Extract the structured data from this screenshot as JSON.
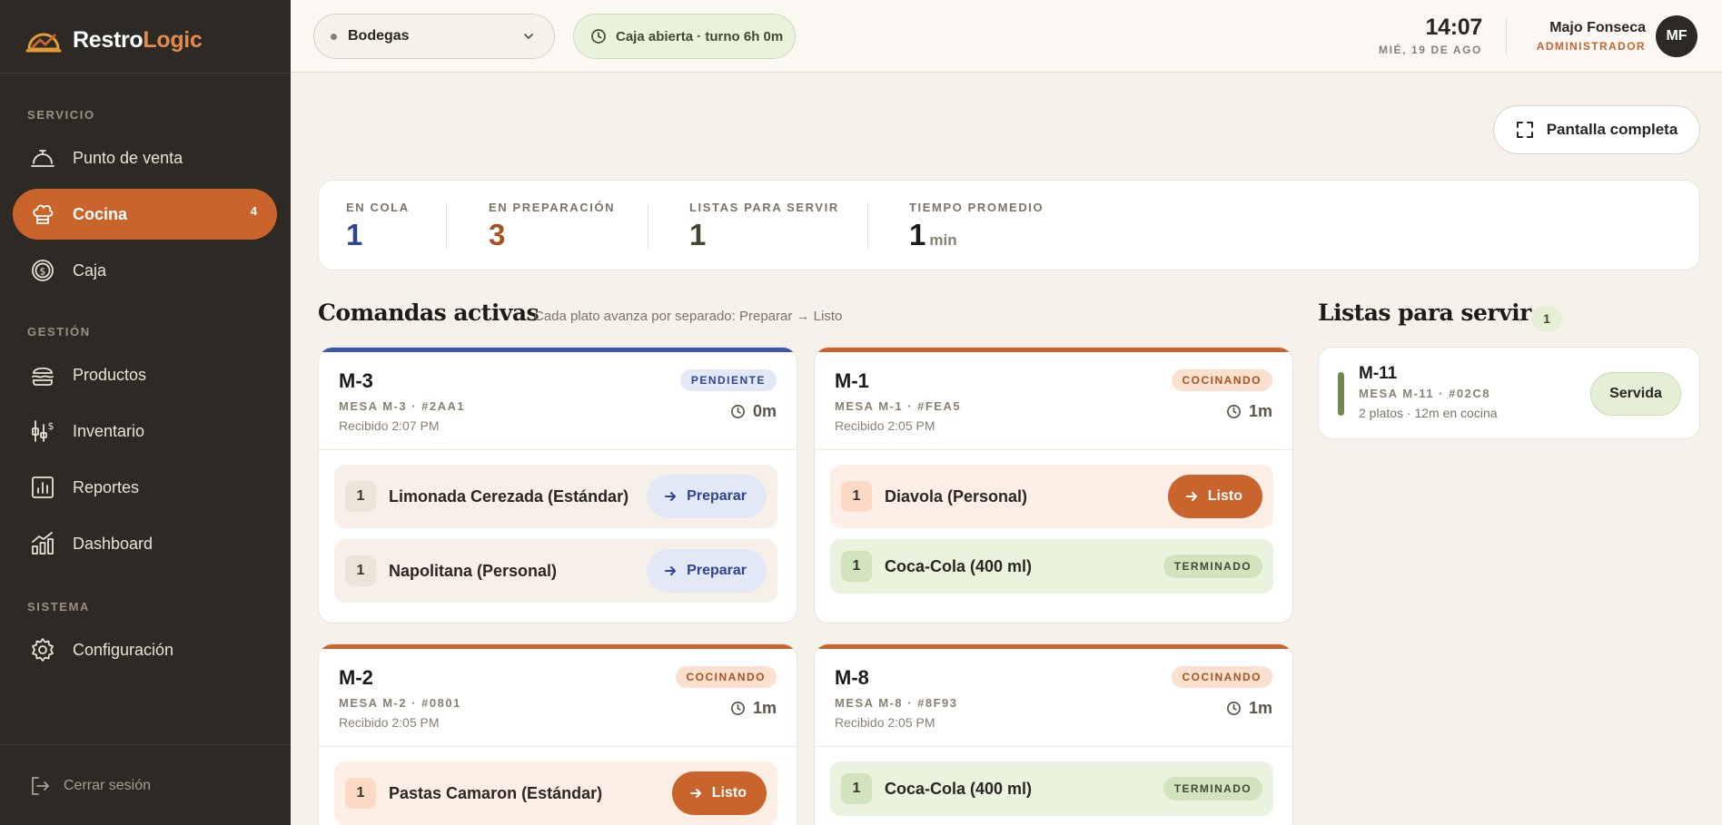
{
  "brand": {
    "name_main": "Restro",
    "name_accent": "Logic"
  },
  "sidebar": {
    "sections": [
      {
        "label": "SERVICIO"
      },
      {
        "label": "GESTIÓN"
      },
      {
        "label": "SISTEMA"
      }
    ],
    "items": [
      {
        "label": "Punto de venta",
        "icon": "service-bell-icon",
        "active": false
      },
      {
        "label": "Cocina",
        "icon": "chef-hat-icon",
        "active": true,
        "badge": "4"
      },
      {
        "label": "Caja",
        "icon": "dollar-coin-icon",
        "active": false
      },
      {
        "label": "Productos",
        "icon": "burger-icon",
        "active": false
      },
      {
        "label": "Inventario",
        "icon": "inventory-scale-icon",
        "active": false
      },
      {
        "label": "Reportes",
        "icon": "bar-chart-icon",
        "active": false
      },
      {
        "label": "Dashboard",
        "icon": "growth-chart-icon",
        "active": false
      },
      {
        "label": "Configuración",
        "icon": "gear-icon",
        "active": false
      }
    ],
    "logout_label": "Cerrar sesión"
  },
  "header": {
    "branch": "Bodegas",
    "cash_status": "Caja abierta · turno 6h 0m",
    "time": "14:07",
    "date": "MIÉ, 19 DE AGO",
    "user_name": "Majo Fonseca",
    "user_role": "ADMINISTRADOR",
    "avatar_initials": "MF"
  },
  "main": {
    "fullscreen_label": "Pantalla completa",
    "stats": [
      {
        "label": "EN COLA",
        "value": "1",
        "unit": "",
        "color": "#2e4592"
      },
      {
        "label": "EN PREPARACIÓN",
        "value": "3",
        "unit": "",
        "color": "#a3541f"
      },
      {
        "label": "LISTAS PARA SERVIR",
        "value": "1",
        "unit": "",
        "color": "#3f4a34"
      },
      {
        "label": "TIEMPO PROMEDIO",
        "value": "1",
        "unit": "min",
        "color": "#1f1b18"
      }
    ],
    "active_title": "Comandas activas",
    "active_subtitle": "Cada plato avanza por separado: Preparar → Listo",
    "ready_title": "Listas para servir",
    "ready_count": "1",
    "orders": [
      {
        "id": "M-3",
        "sub": "MESA M-3 · #2AA1",
        "received": "Recibido 2:07 PM",
        "status": "PENDIENTE",
        "elapsed": "0m",
        "items": [
          {
            "qty": "1",
            "name": "Limonada Cerezada (Estándar)",
            "action": "Preparar"
          },
          {
            "qty": "1",
            "name": "Napolitana (Personal)",
            "action": "Preparar"
          }
        ]
      },
      {
        "id": "M-1",
        "sub": "MESA M-1 · #FEA5",
        "received": "Recibido 2:05 PM",
        "status": "COCINANDO",
        "elapsed": "1m",
        "items": [
          {
            "qty": "1",
            "name": "Diavola (Personal)",
            "action": "Listo"
          },
          {
            "qty": "1",
            "name": "Coca-Cola (400 ml)",
            "done": "TERMINADO"
          }
        ]
      },
      {
        "id": "M-2",
        "sub": "MESA M-2 · #0801",
        "received": "Recibido 2:05 PM",
        "status": "COCINANDO",
        "elapsed": "1m",
        "items": [
          {
            "qty": "1",
            "name": "Pastas Camaron (Estándar)",
            "action": "Listo"
          }
        ]
      },
      {
        "id": "M-8",
        "sub": "MESA M-8 · #8F93",
        "received": "Recibido 2:05 PM",
        "status": "COCINANDO",
        "elapsed": "1m",
        "items": [
          {
            "qty": "1",
            "name": "Coca-Cola (400 ml)",
            "done": "TERMINADO"
          }
        ]
      }
    ],
    "ready_orders": [
      {
        "id": "M-11",
        "sub": "MESA M-11 · #02C8",
        "meta": "2 platos · 12m en cocina",
        "action": "Servida"
      }
    ]
  },
  "colors": {
    "accent": "#c8642c",
    "pending": "#3d56a8",
    "cooking": "#c8642c",
    "done_bg": "#e9f3dd"
  }
}
